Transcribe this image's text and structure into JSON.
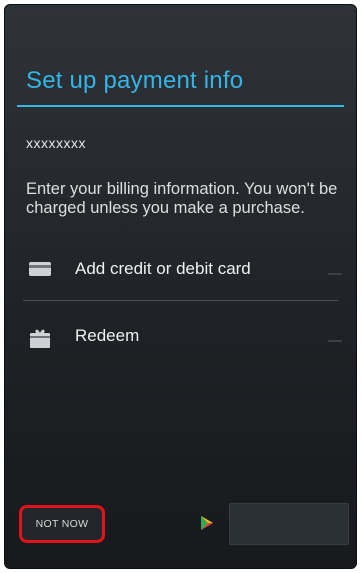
{
  "header": {
    "title": "Set up payment info"
  },
  "account": {
    "masked_email": "xxxxxxxx"
  },
  "info": {
    "text": "Enter your billing information. You won't be charged unless you make a purchase."
  },
  "options": [
    {
      "label": "Add credit or debit card",
      "icon": "credit-card-icon"
    },
    {
      "label": "Redeem",
      "icon": "gift-card-icon"
    }
  ],
  "footer": {
    "not_now_label": "NOT NOW",
    "continue_label": "",
    "accent_color": "#33b5e5",
    "highlight_color": "#e0141a"
  }
}
